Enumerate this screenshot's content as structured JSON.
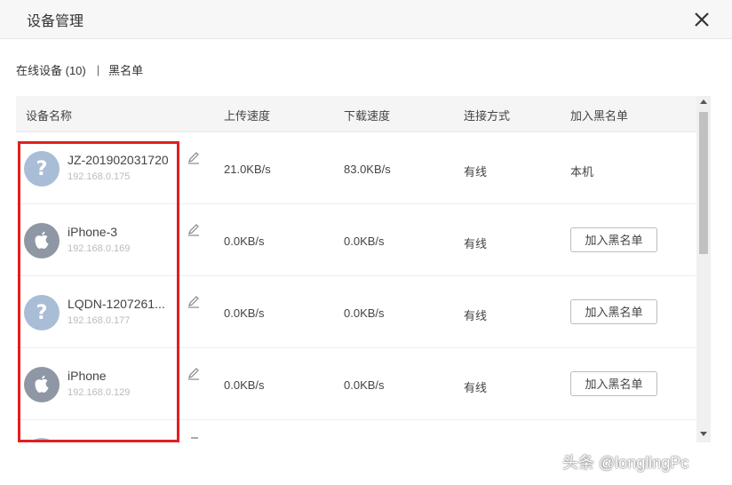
{
  "window": {
    "title": "设备管理",
    "close_icon": "close-icon"
  },
  "tabs": [
    {
      "label": "在线设备 (10)"
    },
    {
      "label": "黑名单"
    }
  ],
  "tab_separator": "|",
  "table": {
    "columns": [
      "设备名称",
      "上传速度",
      "下载速度",
      "连接方式",
      "加入黑名单"
    ],
    "rows": [
      {
        "avatar": "question-icon",
        "name": "JZ-201902031720",
        "ip": "192.168.0.175",
        "upload": "21.0KB/s",
        "download": "83.0KB/s",
        "connection": "有线",
        "blacklist": "本机"
      },
      {
        "avatar": "apple-icon",
        "name": "iPhone-3",
        "ip": "192.168.0.169",
        "upload": "0.0KB/s",
        "download": "0.0KB/s",
        "connection": "有线",
        "blacklist": "加入黑名单"
      },
      {
        "avatar": "question-icon",
        "name": "LQDN-1207261...",
        "ip": "192.168.0.177",
        "upload": "0.0KB/s",
        "download": "0.0KB/s",
        "connection": "有线",
        "blacklist": "加入黑名单"
      },
      {
        "avatar": "apple-icon",
        "name": "iPhone",
        "ip": "192.168.0.129",
        "upload": "0.0KB/s",
        "download": "0.0KB/s",
        "connection": "有线",
        "blacklist": "加入黑名单"
      }
    ]
  },
  "question_mark": "?",
  "watermark": "头条 @longlingPc",
  "colors": {
    "highlight": "#e02020",
    "avatar_unknown": "#a9bdd6",
    "avatar_apple": "#8f97a4"
  }
}
